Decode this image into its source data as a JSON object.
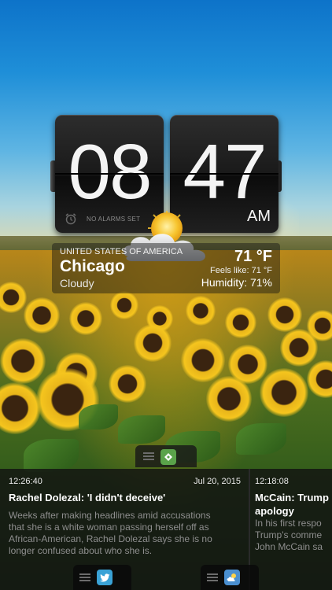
{
  "clock": {
    "hour": "08",
    "minute": "47",
    "ampm": "AM",
    "alarm_status": "NO ALARMS SET"
  },
  "weather": {
    "country": "UNITED STATES OF AMERICA",
    "city": "Chicago",
    "condition": "Cloudy",
    "temperature": "71 °F",
    "feels_like": "Feels like: 71 °F",
    "humidity": "Humidity: 71%",
    "icon": "partly-cloudy-icon"
  },
  "feed_tabs": {
    "top": {
      "icon": "feedly-icon",
      "color": "#5aa34a"
    },
    "bottom": [
      {
        "icon": "twitter-icon",
        "color": "#3aa2d6"
      },
      {
        "icon": "weather-icon",
        "color": "#4a8fd0"
      }
    ]
  },
  "news": [
    {
      "time": "12:26:40",
      "date": "Jul 20, 2015",
      "headline": "Rachel Dolezal: 'I didn't deceive'",
      "body_lines": [
        "Weeks after making headlines amid accusations",
        "that she is a white woman passing herself off as",
        "African-American, Rachel Dolezal says she is no",
        "longer confused about who she is."
      ]
    },
    {
      "time": "12:18:08",
      "headline_lines": [
        "McCain: Trump",
        "apology"
      ],
      "body_lines": [
        "In his first respo",
        "Trump's comme",
        "John McCain sa"
      ]
    }
  ]
}
